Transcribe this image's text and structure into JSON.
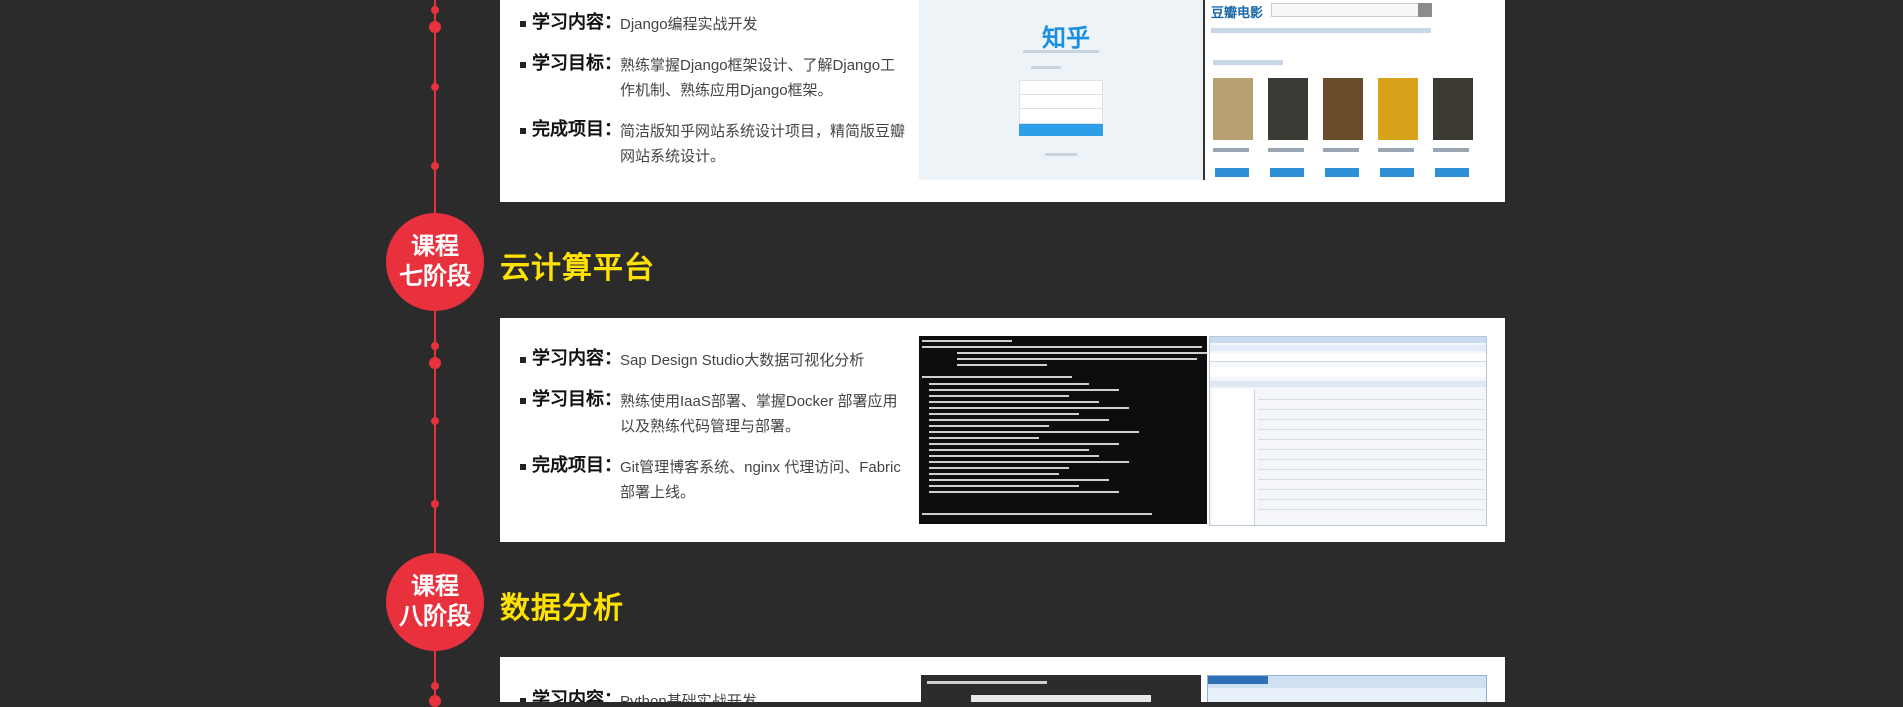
{
  "labels": {
    "content": "学习内容：",
    "goal": "学习目标：",
    "project": "完成项目："
  },
  "stage6": {
    "content": "Django编程实战开发",
    "goal": "熟练掌握Django框架设计、了解Django工作机制、熟练应用Django框架。",
    "project": "简洁版知乎网站系统设计项目，精简版豆瓣网站系统设计。",
    "zhihu_logo": "知乎",
    "douban_logo": "豆瓣电影"
  },
  "stage7": {
    "badge_line1": "课程",
    "badge_line2": "七阶段",
    "title": "云计算平台",
    "content": "Sap Design Studio大数据可视化分析",
    "goal": "熟练使用IaaS部署、掌握Docker 部署应用以及熟练代码管理与部署。",
    "project": "Git管理博客系统、nginx 代理访问、Fabric部署上线。"
  },
  "stage8": {
    "badge_line1": "课程",
    "badge_line2": "八阶段",
    "title": "数据分析",
    "content": "Python基础实战开发"
  },
  "colors": {
    "background": "#2b2b2b",
    "accent_red": "#e8313d",
    "title_yellow": "#ffe200",
    "card": "#ffffff"
  }
}
